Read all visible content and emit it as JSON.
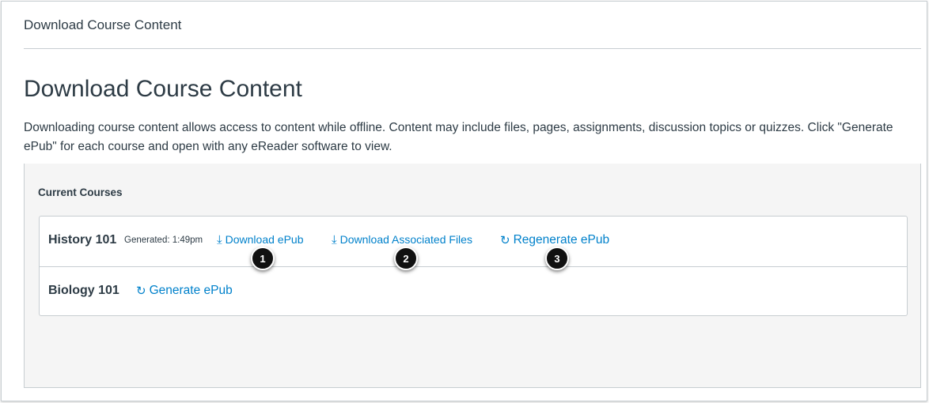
{
  "breadcrumb": "Download Course Content",
  "page_title": "Download Course Content",
  "description": "Downloading course content allows access to content while offline. Content may include files, pages, assignments, discussion topics or quizzes. Click \"Generate ePub\" for each course and open with any eReader software to view.",
  "panel": {
    "title": "Current Courses"
  },
  "courses": [
    {
      "name": "History 101",
      "generated": "Generated: 1:49pm",
      "download_epub": "Download ePub",
      "download_files": "Download Associated Files",
      "regenerate": "Regenerate ePub"
    },
    {
      "name": "Biology 101",
      "generate": "Generate ePub"
    }
  ],
  "callouts": [
    "1",
    "2",
    "3"
  ]
}
